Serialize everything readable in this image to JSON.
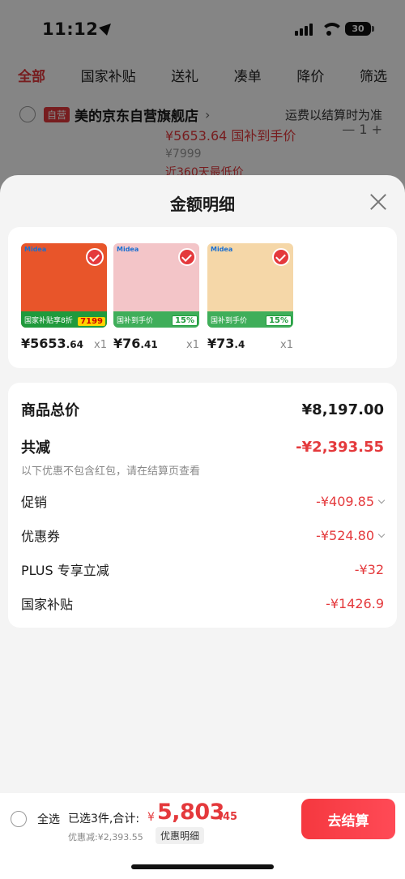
{
  "status_bar": {
    "time": "11:12",
    "battery": "30"
  },
  "tabs": [
    {
      "label": "全部",
      "active": true
    },
    {
      "label": "国家补贴"
    },
    {
      "label": "送礼"
    },
    {
      "label": "凑单"
    },
    {
      "label": "降价"
    },
    {
      "label": "筛选"
    }
  ],
  "store": {
    "badge": "自营",
    "name": "美的京东自营旗舰店",
    "shipping": "运费以结算时为准"
  },
  "bg_product": {
    "price": "¥5653.64 国补到手价",
    "original": "¥7999",
    "low": "近360天最低价"
  },
  "sheet": {
    "title": "金额明细"
  },
  "products": [
    {
      "price_int": "¥5653",
      "price_dec": ".64",
      "qty": "x1",
      "brand": "Midea",
      "strip": "国家补贴享8折",
      "tag": "7199",
      "bg": "#e8552a"
    },
    {
      "price_int": "¥76",
      "price_dec": ".41",
      "qty": "x1",
      "brand": "Midea",
      "strip": "国补到手价",
      "tag": "15%",
      "bg": "#f3c5c8"
    },
    {
      "price_int": "¥73",
      "price_dec": ".4",
      "qty": "x1",
      "brand": "Midea",
      "strip": "国补到手价",
      "tag": "15%",
      "bg": "#f5d7a8"
    }
  ],
  "summary": {
    "total_label": "商品总价",
    "total_value": "¥8,197.00",
    "reduce_label": "共减",
    "reduce_value": "-¥2,393.55",
    "reduce_note": "以下优惠不包含红包，请在结算页查看",
    "promo_label": "促销",
    "promo_value": "-¥409.85",
    "coupon_label": "优惠券",
    "coupon_value": "-¥524.80",
    "plus_label": "PLUS 专享立减",
    "plus_value": "-¥32",
    "subsidy_label": "国家补贴",
    "subsidy_value": "-¥1426.9"
  },
  "bottom": {
    "select_all": "全选",
    "selected_info": "已选3件,合计:",
    "currency": "¥",
    "amount": "5,803",
    "cents": ".45",
    "discount": "优惠减:¥2,393.55",
    "detail": "优惠明细",
    "checkout": "去结算"
  },
  "colors": {
    "accent": "#e4393c",
    "background": "#f4f4f4"
  }
}
